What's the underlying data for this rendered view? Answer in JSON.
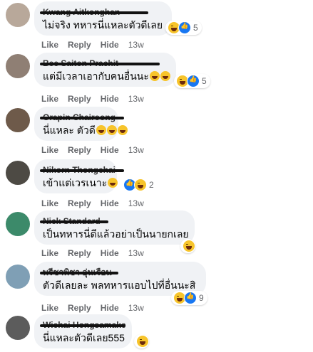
{
  "actions": {
    "like": "Like",
    "reply": "Reply",
    "hide": "Hide"
  },
  "comments": [
    {
      "name": "Kwang Aitkonghan",
      "text": "ไม่จริง ทหารนี่แหละตัวดีเลย",
      "emoji_count": 0,
      "time": "13w",
      "react_count": "5",
      "reactions": [
        "haha",
        "like"
      ],
      "avatar_color": "#b8a89a"
    },
    {
      "name": "Bee Saiton Prachit",
      "text": "แต่มีเวลาเอากับคนอื่นนะ",
      "emoji_count": 2,
      "time": "13w",
      "react_count": "5",
      "reactions": [
        "haha",
        "like"
      ],
      "avatar_color": "#8f7f74"
    },
    {
      "name": "Orapin Chairoong",
      "text": "นี่แหละ ตัวดี",
      "emoji_count": 3,
      "time": "13w",
      "react_count": "",
      "reactions": [],
      "avatar_color": "#6e5a4a"
    },
    {
      "name": "Nikorn Thongchai",
      "text": "เข้าแต่เวรเนาะ",
      "emoji_count": 1,
      "time": "13w",
      "react_count": "2",
      "reactions": [
        "like",
        "haha"
      ],
      "avatar_color": "#4d4a44"
    },
    {
      "name": "Nick Standard",
      "text": "เป็นทหารนี่ดีแล้วอย่าเป็นนายกเลย",
      "emoji_count": 0,
      "time": "13w",
      "react_count": "",
      "reactions": [
        "haha"
      ],
      "avatar_color": "#3c8a6a"
    },
    {
      "name": "พรีชาพิชา อุ่นเรือน",
      "text": "ตัวดีเลยละ พลทหารแอบไปที่อื่นนะสิ",
      "emoji_count": 0,
      "time": "13w",
      "react_count": "9",
      "reactions": [
        "haha",
        "like"
      ],
      "avatar_color": "#7f9fb5"
    },
    {
      "name": "Wichai Hongsamake",
      "text": "นี่แหละตัวดีเลย555",
      "emoji_count": 0,
      "time": "",
      "react_count": "",
      "reactions": [
        "haha"
      ],
      "avatar_color": "#5c5c5c"
    }
  ]
}
